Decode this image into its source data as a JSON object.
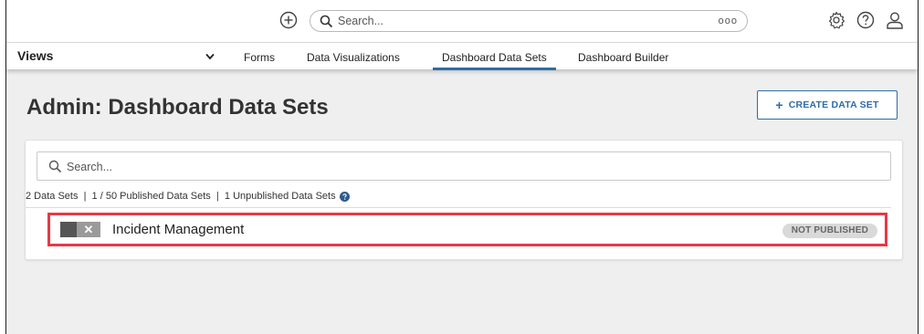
{
  "topbar": {
    "search_placeholder": "Search...",
    "search_more": "ooo"
  },
  "nav": {
    "views_label": "Views",
    "tabs": [
      {
        "label": "Forms",
        "active": false
      },
      {
        "label": "Data Visualizations",
        "active": false
      },
      {
        "label": "Dashboard Data Sets",
        "active": true
      },
      {
        "label": "Dashboard Builder",
        "active": false
      }
    ]
  },
  "page": {
    "title": "Admin: Dashboard Data Sets",
    "create_button": "CREATE DATA SET"
  },
  "list": {
    "search_placeholder": "Search...",
    "summary": "2 Data Sets  |  1 / 50 Published Data Sets  |  1 Unpublished Data Sets",
    "items": [
      {
        "name": "Incident Management",
        "status": "NOT PUBLISHED",
        "published": false
      }
    ]
  },
  "colors": {
    "accent": "#2e6ca4",
    "highlight": "#e63946",
    "background": "#efefef"
  }
}
